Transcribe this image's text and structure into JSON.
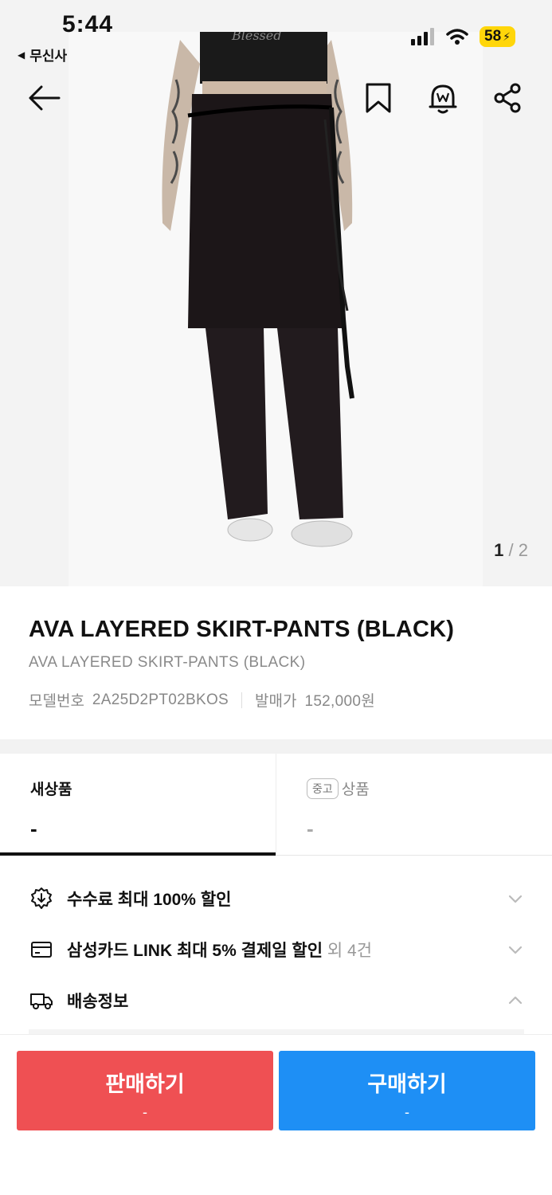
{
  "status_bar": {
    "time": "5:44",
    "back_app": "무신사",
    "battery": "58"
  },
  "gallery": {
    "current": "1",
    "separator": " / ",
    "total": "2",
    "print_text": "Blessed"
  },
  "product": {
    "title": "AVA LAYERED SKIRT-PANTS (BLACK)",
    "subtitle": "AVA LAYERED SKIRT-PANTS (BLACK)",
    "model_label": "모델번호",
    "model_value": "2A25D2PT02BKOS",
    "release_label": "발매가",
    "release_value": "152,000원"
  },
  "tabs": {
    "new": {
      "label": "새상품",
      "price": "-"
    },
    "used": {
      "tag": "중고",
      "label": "상품",
      "price": "-"
    }
  },
  "benefits": [
    {
      "icon": "discount-badge-icon",
      "text": "수수료 최대 100% 할인",
      "extra": ""
    },
    {
      "icon": "card-icon",
      "text": "삼성카드 LINK 최대 5% 결제일 할인",
      "extra": " 외 4건"
    },
    {
      "icon": "truck-icon",
      "text": "배송정보",
      "extra": ""
    }
  ],
  "actions": {
    "sell": {
      "label": "판매하기",
      "price": "-"
    },
    "buy": {
      "label": "구매하기",
      "price": "-"
    }
  },
  "colors": {
    "sell": "#ef5053",
    "buy": "#1e8ff5",
    "battery": "#ffd60a"
  }
}
